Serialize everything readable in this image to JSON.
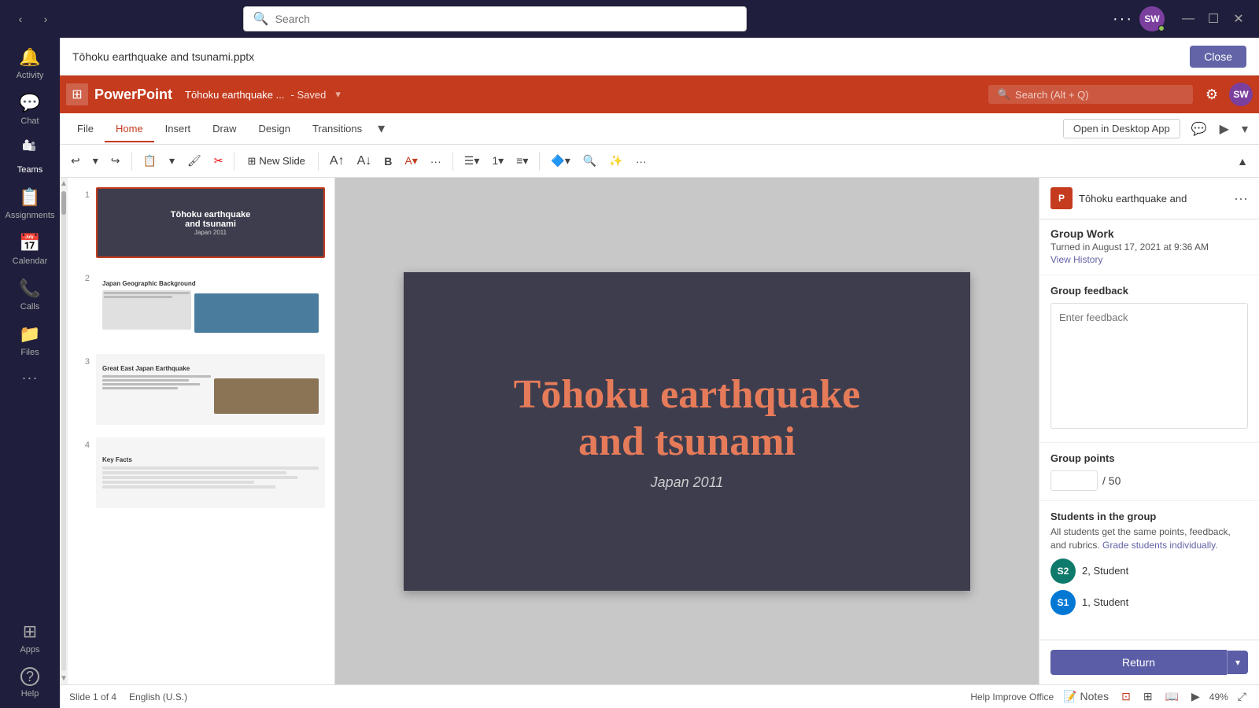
{
  "topbar": {
    "search_placeholder": "Search",
    "nav_back": "‹",
    "nav_forward": "›",
    "more_label": "···",
    "user_initials": "SW",
    "minimize": "—",
    "maximize": "☐",
    "close": "✕"
  },
  "sidebar": {
    "items": [
      {
        "id": "activity",
        "label": "Activity",
        "icon": "🔔",
        "active": false
      },
      {
        "id": "chat",
        "label": "Chat",
        "icon": "💬",
        "active": false
      },
      {
        "id": "teams",
        "label": "Teams",
        "icon": "👥",
        "active": true
      },
      {
        "id": "assignments",
        "label": "Assignments",
        "icon": "📋",
        "active": false
      },
      {
        "id": "calendar",
        "label": "Calendar",
        "icon": "📅",
        "active": false
      },
      {
        "id": "calls",
        "label": "Calls",
        "icon": "📞",
        "active": false
      },
      {
        "id": "files",
        "label": "Files",
        "icon": "📁",
        "active": false
      },
      {
        "id": "more",
        "label": "···",
        "icon": "···",
        "active": false
      },
      {
        "id": "apps",
        "label": "Apps",
        "icon": "⊞",
        "active": false
      },
      {
        "id": "help",
        "label": "Help",
        "icon": "?",
        "active": false
      }
    ]
  },
  "file_header": {
    "title": "Tōhoku earthquake and tsunami.pptx",
    "close_label": "Close"
  },
  "ppt": {
    "app_name": "PowerPoint",
    "file_name": "Tōhoku earthquake ...",
    "saved_label": "- Saved",
    "search_placeholder": "Search (Alt + Q)",
    "tabs": [
      {
        "id": "file",
        "label": "File",
        "active": false
      },
      {
        "id": "home",
        "label": "Home",
        "active": true
      },
      {
        "id": "insert",
        "label": "Insert",
        "active": false
      },
      {
        "id": "draw",
        "label": "Draw",
        "active": false
      },
      {
        "id": "design",
        "label": "Design",
        "active": false
      },
      {
        "id": "transitions",
        "label": "Transitions",
        "active": false
      }
    ],
    "open_desktop_label": "Open in Desktop App",
    "slides": [
      {
        "num": "1",
        "title": "Tōhoku earthquake and tsunami",
        "subtitle": "Japan 2011",
        "selected": true
      },
      {
        "num": "2",
        "title": "Japan Geographic Background",
        "selected": false
      },
      {
        "num": "3",
        "title": "Great East Japan Earthquake",
        "selected": false
      },
      {
        "num": "4",
        "title": "Key Facts",
        "selected": false
      }
    ],
    "main_slide": {
      "title_part1": "Tōhoku earthquake",
      "title_part2": "and tsunami",
      "subtitle": "Japan 2011"
    },
    "status": {
      "slide_info": "Slide 1 of 4",
      "language": "English (U.S.)",
      "help_improve": "Help Improve Office",
      "notes_label": "Notes",
      "zoom": "49%"
    },
    "toolbar": {
      "new_slide": "New Slide"
    }
  },
  "right_panel": {
    "file_icon_text": "P",
    "file_name": "Tōhoku earthquake and",
    "group_work_title": "Group Work",
    "turned_in_text": "Turned in August 17, 2021 at 9:36 AM",
    "view_history_label": "View History",
    "group_feedback_label": "Group feedback",
    "feedback_placeholder": "Enter feedback",
    "group_points_label": "Group points",
    "points_denom": "/ 50",
    "students_title": "Students in the group",
    "students_desc": "All students get the same points, feedback, and rubrics.",
    "grade_individually_label": "Grade students individually.",
    "students": [
      {
        "id": "s2",
        "initials": "S2",
        "name": "2, Student",
        "color": "#0e7a6b"
      },
      {
        "id": "s1",
        "initials": "S1",
        "name": "1, Student",
        "color": "#0078d4"
      }
    ],
    "return_label": "Return",
    "return_chevron": "▾"
  }
}
